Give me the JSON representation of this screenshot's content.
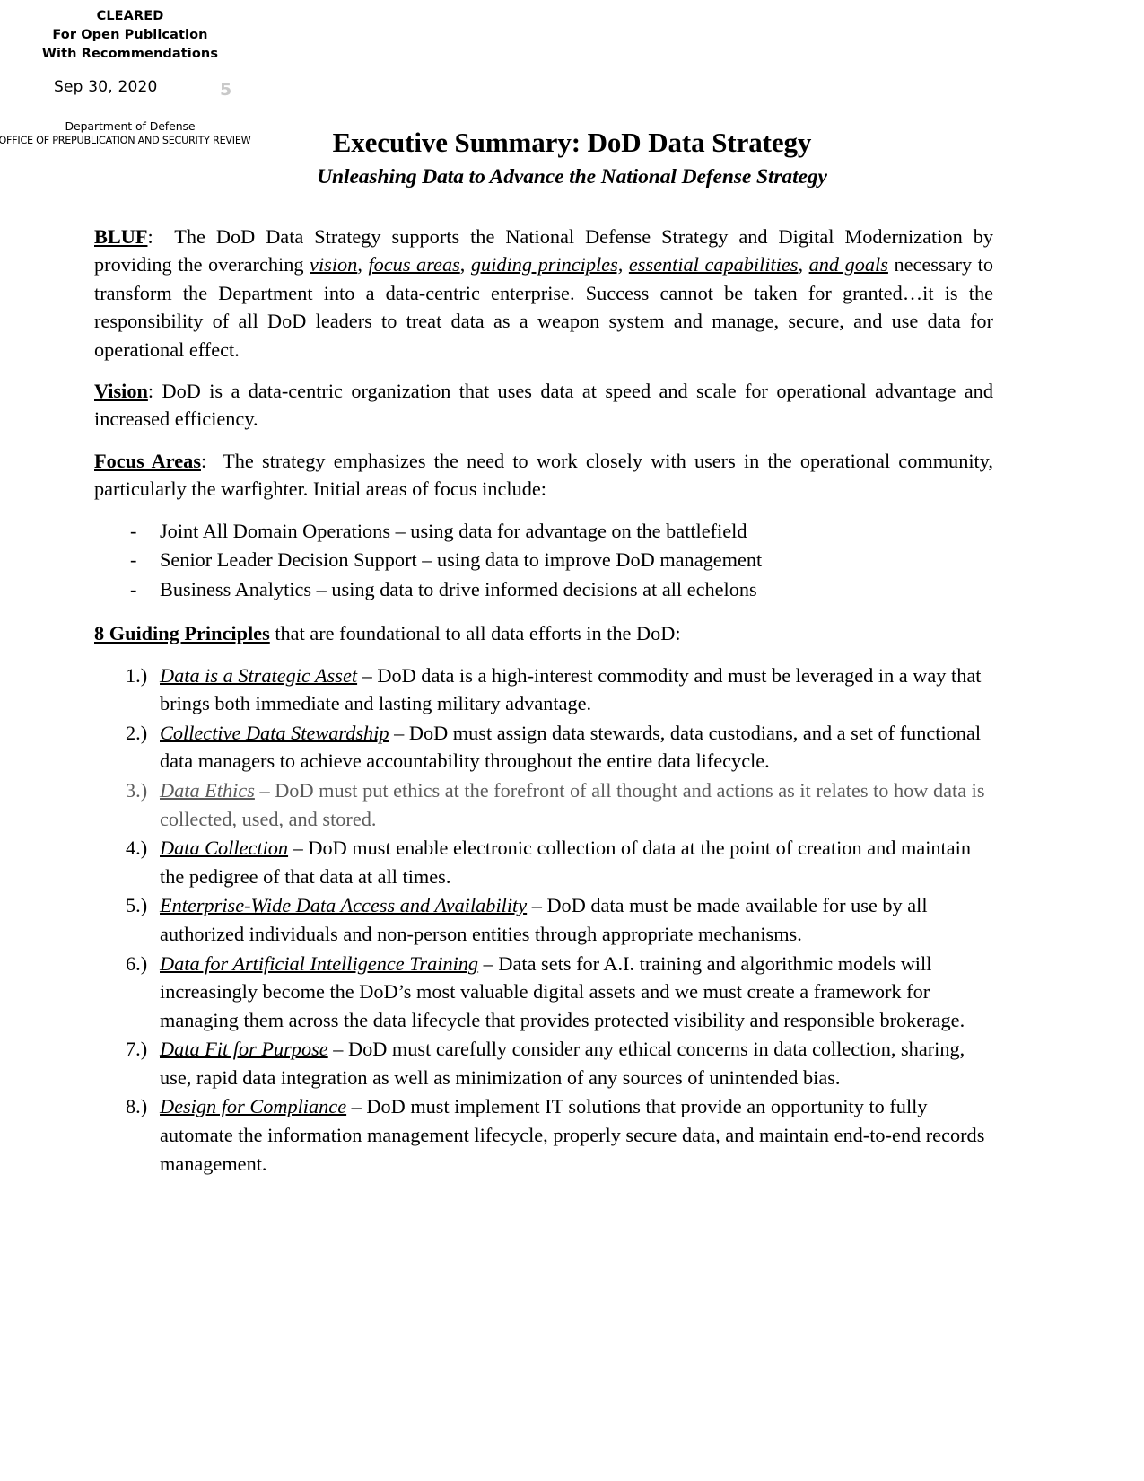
{
  "stamp": {
    "line1": "CLEARED",
    "line2": "For Open Publication",
    "line3": "With Recommendations",
    "date": "Sep 30, 2020",
    "marker": "5",
    "org": "Department of Defense",
    "office": "OFFICE OF PREPUBLICATION AND SECURITY REVIEW"
  },
  "title": {
    "main": "Executive Summary: DoD Data Strategy",
    "subtitle": "Unleashing Data to Advance the National Defense Strategy"
  },
  "bluf": {
    "label": "BLUF",
    "colon": ":",
    "text_1": "The DoD Data Strategy supports the National Defense Strategy and Digital Modernization by providing the overarching ",
    "em_vision": "vision",
    "sep_1": ", ",
    "em_focus_areas": "focus areas",
    "sep_2": ", ",
    "em_guiding_principles": "guiding principles,",
    "sep_3": " ",
    "em_essential_capabilities": "essential capabilities",
    "sep_4": ", ",
    "em_and_goals": "and goals",
    "text_2": " necessary to transform the Department into a data-centric enterprise. Success cannot be taken for granted…it is the responsibility of all DoD leaders to treat data as a weapon system and manage, secure, and use data for operational effect."
  },
  "vision": {
    "label": "Vision",
    "colon": ": ",
    "text": "DoD is a data-centric organization that uses data at speed and scale for operational advantage and increased efficiency."
  },
  "focus_areas": {
    "label": "Focus Areas",
    "colon": ":",
    "intro": "The strategy emphasizes the need to work closely with users in the operational community, particularly the warfighter. Initial areas of focus include:",
    "marker": "-",
    "items": [
      "Joint All Domain Operations – using data for advantage on the battlefield",
      "Senior Leader Decision Support – using data to improve DoD management",
      "Business Analytics – using data to drive informed decisions at all echelons"
    ]
  },
  "principles": {
    "heading_bold": "8 Guiding Principles",
    "heading_rest": " that are foundational to all data efforts in the DoD:",
    "items": [
      {
        "num": "1.)",
        "name": "Data is a Strategic Asset",
        "body": " – DoD data is a high-interest commodity and must be leveraged in a way that brings both immediate and lasting military advantage.",
        "faded": false
      },
      {
        "num": "2.)",
        "name": "Collective Data Stewardship",
        "body": " – DoD must assign data stewards, data custodians, and a set of functional data managers to achieve accountability throughout the entire data lifecycle.",
        "faded": false
      },
      {
        "num": "3.)",
        "name": "Data Ethics",
        "body": " – DoD must put ethics at the forefront of all thought and actions as it relates to how data is collected, used, and stored.",
        "faded": true
      },
      {
        "num": "4.)",
        "name": "Data Collection",
        "body": " – DoD must enable electronic collection of data at the point of creation and maintain the pedigree of that data at all times.",
        "faded": false
      },
      {
        "num": "5.)",
        "name": "Enterprise-Wide Data Access and Availability",
        "body": " – DoD data must be made available for use by all authorized individuals and non-person entities through appropriate mechanisms.",
        "faded": false
      },
      {
        "num": "6.)",
        "name": "Data for Artificial Intelligence Training",
        "body": " – Data sets for A.I. training and algorithmic models will increasingly become the DoD’s most valuable digital assets and we must create a framework for managing them across the data lifecycle that provides protected visibility and responsible brokerage.",
        "faded": false
      },
      {
        "num": "7.)",
        "name": "Data Fit for Purpose",
        "body": " – DoD must carefully consider any ethical concerns in data collection, sharing, use, rapid data integration as well as minimization of any sources of unintended bias.",
        "faded": false
      },
      {
        "num": "8.)",
        "name": "Design for Compliance",
        "body": " – DoD must implement IT solutions that provide an opportunity to fully automate the information management lifecycle, properly secure data, and maintain end-to-end records management.",
        "faded": false
      }
    ]
  }
}
